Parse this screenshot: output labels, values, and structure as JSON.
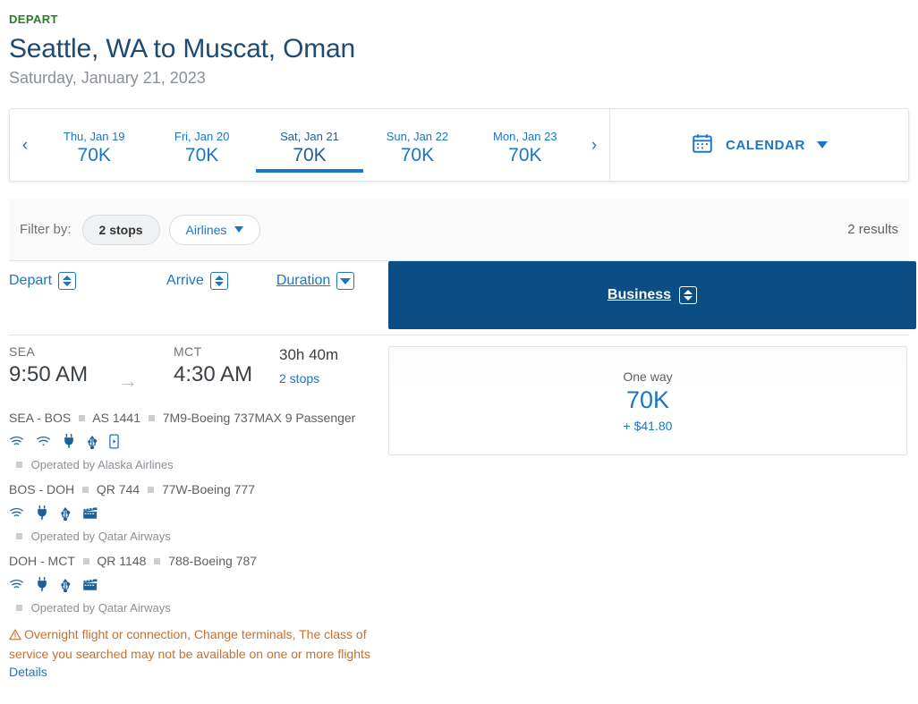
{
  "header": {
    "eyebrow": "DEPART",
    "route": "Seattle, WA to Muscat, Oman",
    "date": "Saturday, January 21, 2023"
  },
  "date_strip": {
    "prev": "‹",
    "next": "›",
    "days": [
      {
        "label": "Thu, Jan 19",
        "price": "70K",
        "active": false
      },
      {
        "label": "Fri, Jan 20",
        "price": "70K",
        "active": false
      },
      {
        "label": "Sat, Jan 21",
        "price": "70K",
        "active": true
      },
      {
        "label": "Sun, Jan 22",
        "price": "70K",
        "active": false
      },
      {
        "label": "Mon, Jan 23",
        "price": "70K",
        "active": false
      }
    ],
    "calendar_label": "CALENDAR"
  },
  "filters": {
    "filter_by_label": "Filter by:",
    "chips": [
      {
        "label": "2 stops",
        "type": "selected"
      },
      {
        "label": "Airlines",
        "type": "dropdown"
      }
    ],
    "results_count": "2 results"
  },
  "columns": {
    "depart": "Depart",
    "arrive": "Arrive",
    "duration": "Duration",
    "fare_class": "Business"
  },
  "itinerary": {
    "origin_code": "SEA",
    "depart_time": "9:50 AM",
    "destination_code": "MCT",
    "arrive_time": "4:30 AM",
    "duration": "30h 40m",
    "stops": "2 stops",
    "segments": [
      {
        "route": "SEA - BOS",
        "flight": "AS 1441",
        "aircraft": "7M9-Boeing 737MAX 9 Passenger",
        "amenities": [
          "wifi-icon",
          "wifi-signal-icon",
          "power-outlet-icon",
          "usb-port-icon",
          "streaming-device-icon"
        ],
        "operated_by": "Operated by Alaska Airlines"
      },
      {
        "route": "BOS - DOH",
        "flight": "QR 744",
        "aircraft": "77W-Boeing 777",
        "amenities": [
          "wifi-icon",
          "power-outlet-icon",
          "usb-port-icon",
          "movies-icon"
        ],
        "operated_by": "Operated by Qatar Airways"
      },
      {
        "route": "DOH - MCT",
        "flight": "QR 1148",
        "aircraft": "788-Boeing 787",
        "amenities": [
          "wifi-icon",
          "power-outlet-icon",
          "usb-port-icon",
          "movies-icon"
        ],
        "operated_by": "Operated by Qatar Airways"
      }
    ],
    "warning": "Overnight flight or connection, Change terminals, The class of service you searched may not be available on one or more flights",
    "details_link": "Details"
  },
  "fare": {
    "type": "One way",
    "points": "70K",
    "cash": "+ $41.80"
  },
  "colors": {
    "brand_blue": "#1a76c6",
    "header_navy": "#0b4e85",
    "title_navy": "#1f4a72",
    "depart_green": "#2a7d2e",
    "warning_orange": "#c8702c"
  }
}
